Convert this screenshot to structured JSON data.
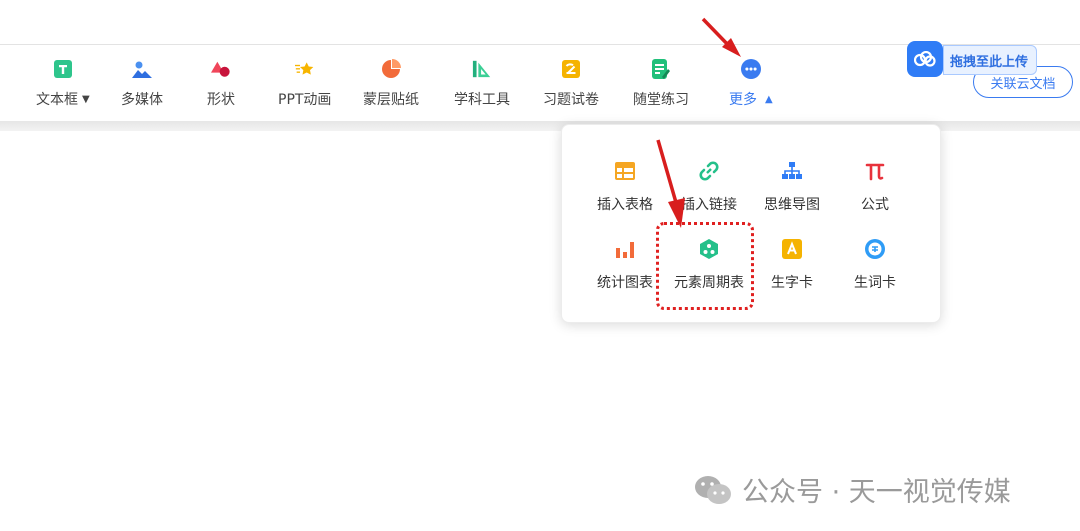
{
  "toolbar": {
    "items": [
      {
        "label": "文本框",
        "icon": "textbox-icon"
      },
      {
        "label": "多媒体",
        "icon": "multimedia-icon"
      },
      {
        "label": "形状",
        "icon": "shape-icon"
      },
      {
        "label": "PPT动画",
        "icon": "ppt-animation-icon"
      },
      {
        "label": "蒙层贴纸",
        "icon": "mask-sticker-icon"
      },
      {
        "label": "学科工具",
        "icon": "subject-tools-icon"
      },
      {
        "label": "习题试卷",
        "icon": "exercise-paper-icon"
      },
      {
        "label": "随堂练习",
        "icon": "class-practice-icon"
      },
      {
        "label": "更多",
        "icon": "more-icon"
      }
    ]
  },
  "cloud": {
    "drag_upload_label": "拖拽至此上传",
    "link_cloud_doc_label": "关联云文档"
  },
  "more_menu": {
    "items": [
      {
        "label": "插入表格",
        "icon": "insert-table-icon"
      },
      {
        "label": "插入链接",
        "icon": "insert-link-icon"
      },
      {
        "label": "思维导图",
        "icon": "mind-map-icon"
      },
      {
        "label": "公式",
        "icon": "formula-icon"
      },
      {
        "label": "统计图表",
        "icon": "statistics-chart-icon"
      },
      {
        "label": "元素周期表",
        "icon": "periodic-table-icon"
      },
      {
        "label": "生字卡",
        "icon": "char-card-icon"
      },
      {
        "label": "生词卡",
        "icon": "word-card-icon"
      }
    ]
  },
  "watermark": {
    "text": "公众号 · 天一视觉传媒"
  },
  "colors": {
    "accent": "#3a7bf0",
    "highlight": "#e02020"
  }
}
